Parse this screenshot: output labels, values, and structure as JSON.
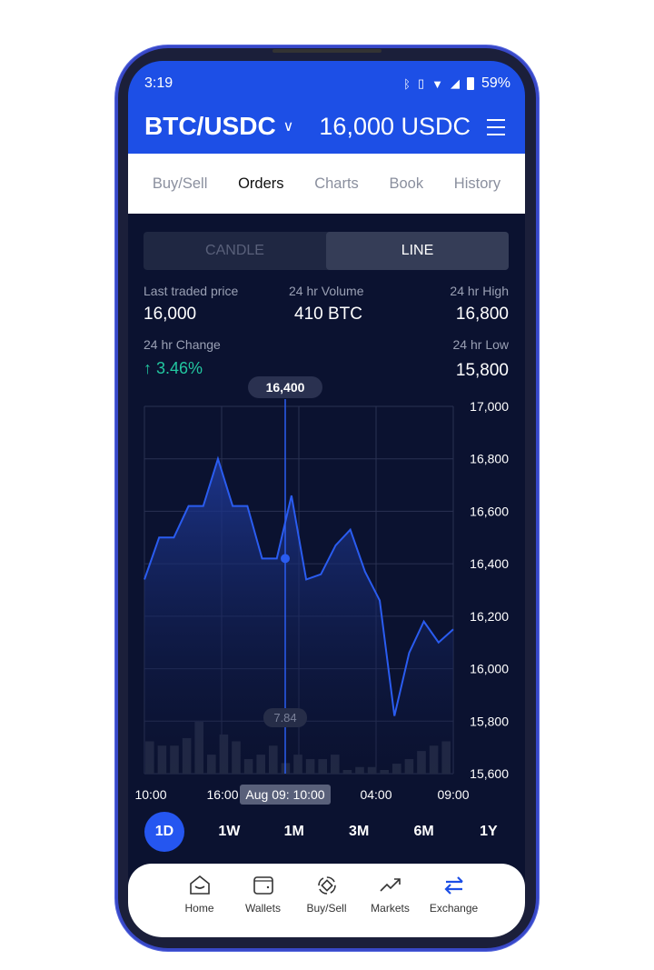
{
  "status": {
    "time": "3:19",
    "battery": "59%",
    "icons": [
      "bluetooth-icon",
      "vibrate-icon",
      "wifi-icon",
      "signal-icon",
      "battery-icon"
    ]
  },
  "header": {
    "pair": "BTC/USDC",
    "balance": "16,000 USDC"
  },
  "tabs": [
    {
      "label": "Buy/Sell"
    },
    {
      "label": "Orders",
      "active": true
    },
    {
      "label": "Charts"
    },
    {
      "label": "Book"
    },
    {
      "label": "History"
    }
  ],
  "chart_toggle": {
    "candle": "CANDLE",
    "line": "LINE",
    "selected": "LINE"
  },
  "stats": {
    "last_label": "Last traded price",
    "last": "16,000",
    "vol_label": "24 hr Volume",
    "vol": "410 BTC",
    "high_label": "24 hr High",
    "high": "16,800",
    "change_label": "24 hr Change",
    "change": "3.46%",
    "low_label": "24 hr Low",
    "low": "15,800"
  },
  "colors": {
    "accent": "#1d4fe6",
    "up": "#22c7a0",
    "bg": "#0b1230"
  },
  "chart_data": {
    "type": "area",
    "ylim": [
      15600,
      17000
    ],
    "yticks": [
      "17,000",
      "16,800",
      "16,600",
      "16,400",
      "16,200",
      "16,000",
      "15,800",
      "15,600"
    ],
    "xticks": [
      "10:00",
      "16:00",
      "04:00",
      "09:00"
    ],
    "values": [
      16340,
      16500,
      16500,
      16620,
      16620,
      16800,
      16620,
      16620,
      16420,
      16420,
      16660,
      16340,
      16360,
      16470,
      16530,
      16370,
      16260,
      15820,
      16060,
      16180,
      16100,
      16150
    ],
    "volume": [
      24,
      20.8,
      20.8,
      26.4,
      38.5,
      14.1,
      29.1,
      24,
      10.8,
      14.1,
      20.8,
      7.84,
      14.1,
      10.8,
      10.8,
      14.1,
      2.7,
      4.9,
      4.9,
      2.7,
      7.4,
      10.8,
      16.8,
      20.8,
      24
    ],
    "crosshair": {
      "price": "16,400",
      "volume": "7.84",
      "time": "Aug 09: 10:00"
    }
  },
  "ranges": [
    {
      "label": "1D",
      "active": true
    },
    {
      "label": "1W"
    },
    {
      "label": "1M"
    },
    {
      "label": "3M"
    },
    {
      "label": "6M"
    },
    {
      "label": "1Y"
    }
  ],
  "nav": [
    {
      "label": "Home"
    },
    {
      "label": "Wallets"
    },
    {
      "label": "Buy/Sell"
    },
    {
      "label": "Markets"
    },
    {
      "label": "Exchange",
      "active": true
    }
  ]
}
